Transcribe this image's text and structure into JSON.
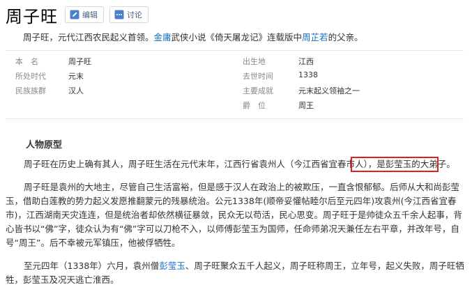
{
  "title": "周子旺",
  "buttons": {
    "edit": "编辑",
    "discuss": "讨论"
  },
  "summary": {
    "part1": "周子旺，元代江西农民起义首领。",
    "link1": "金庸",
    "part2": "武侠小说《倚天屠龙记》连载版中",
    "link2": "周芷若",
    "part3": "的父亲。"
  },
  "info": {
    "rows": [
      {
        "k1": "本　名",
        "v1": "周子旺",
        "k2": "出生地",
        "v2": "江西"
      },
      {
        "k1": "所处时代",
        "v1": "元末",
        "k2": "去世时间",
        "v2": "1338"
      },
      {
        "k1": "民族族群",
        "v1": "汉人",
        "k2": "主要成就",
        "v2": "元末起义领袖之一"
      },
      {
        "k1": "",
        "v1": "",
        "k2": "爵　位",
        "v2": "周王"
      }
    ]
  },
  "section": {
    "heading": "人物原型"
  },
  "paragraphs": {
    "p1_a": "周子旺在历史上确有其人，周子旺生活在元代末年，江西行省袁州人（今江西省宜春市人），",
    "p1_b": "是彭莹玉的大弟子。",
    "p2": "周子旺是袁州的大地主，尽管自己生活富裕，但是感于汉人在政治上的被欺压，一直含恨郁郁。后师从大和尚彭莹玉，借助白莲教的势力起义发愿推翻蒙元的残暴统治。公元1338年(顺帝妥懽帖睦尔后至元四年)攻袁州(今江西省宜春市)，江西湖南天灾连连，但是统治者却依然横征暴敛，民众无以苟活，民心思变。周子旺于是帅徒众五千余人起事，背心皆书以“佛”字，徒众认为有“佛”字可以刀枪不入，以师傅彭莹玉为国师，任命师弟况天兼任左右平章，并改年号，自号“周王”。后不幸被元军镇压，他被俘牺牲。",
    "p3_a": "至元四年（1338年）六月，袁州僧",
    "p3_link": "彭莹玉",
    "p3_b": "、周子旺聚众五千人起义，周子旺称周王，立年号，起义失败，周子旺牺牲，彭莹玉及况天逃亡淮西。"
  }
}
